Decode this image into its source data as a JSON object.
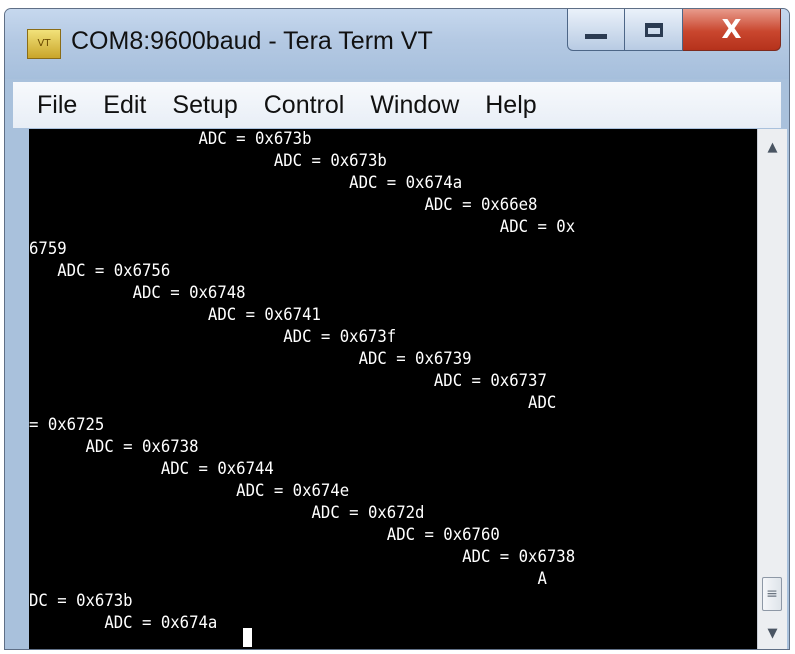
{
  "window": {
    "title": "COM8:9600baud - Tera Term VT",
    "app_icon": "teraterm-icon",
    "controls": [
      "minimize-icon",
      "maximize-icon",
      "close-icon"
    ],
    "close_glyph": "X"
  },
  "menu": {
    "items": [
      "File",
      "Edit",
      "Setup",
      "Control",
      "Window",
      "Help"
    ]
  },
  "terminal": {
    "background": "#000000",
    "foreground": "#ffffff",
    "lines": [
      "                  ADC = 0x673b",
      "                          ADC = 0x673b",
      "                                  ADC = 0x674a",
      "                                          ADC = 0x66e8",
      "                                                  ADC = 0x",
      "6759",
      "   ADC = 0x6756",
      "           ADC = 0x6748",
      "                   ADC = 0x6741",
      "                           ADC = 0x673f",
      "                                   ADC = 0x6739",
      "                                           ADC = 0x6737",
      "                                                     ADC",
      "= 0x6725",
      "      ADC = 0x6738",
      "              ADC = 0x6744",
      "                      ADC = 0x674e",
      "                              ADC = 0x672d",
      "                                      ADC = 0x6760",
      "                                              ADC = 0x6738",
      "                                                      A",
      "DC = 0x673b",
      "        ADC = 0x674a"
    ]
  },
  "scrollbar": {
    "up_glyph": "▲",
    "down_glyph": "▼",
    "thumb_glyph": "≡"
  }
}
